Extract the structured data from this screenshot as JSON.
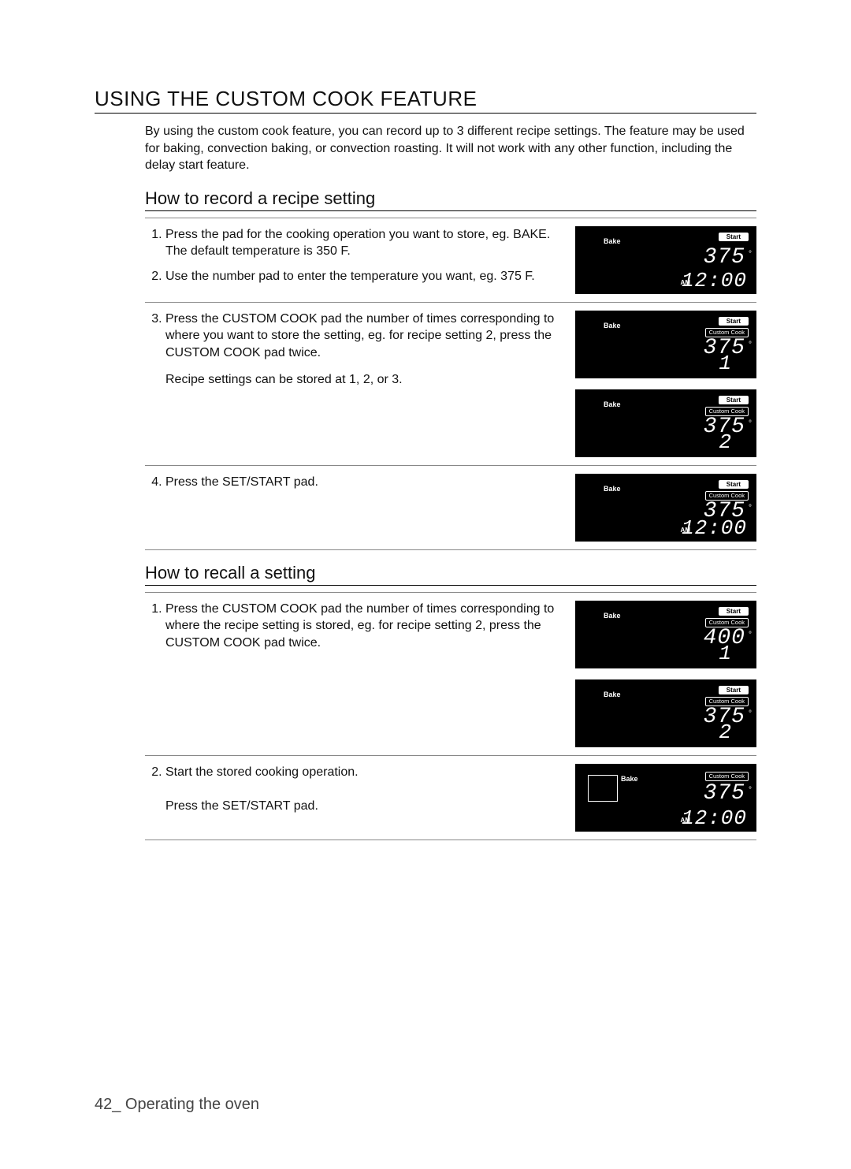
{
  "title": "USING THE CUSTOM COOK FEATURE",
  "intro": "By using the custom cook feature, you can record up to 3 different recipe settings. The feature may be used for baking, convection baking, or convection roasting. It will not work with any other function, including the delay start feature.",
  "section_record_title": "How to record a recipe setting",
  "record_steps": {
    "s1": "Press the pad for the cooking operation you want to store, eg. BAKE. The default temperature is 350 F.",
    "s2": "Use the number pad to enter the temperature you want, eg. 375 F.",
    "s3a": "Press the",
    "s3pad": "CUSTOM COOK",
    "s3b": " pad the number of times corresponding to where you want to store the setting, eg. for recipe setting 2, press the",
    "s3c": " pad twice.",
    "s3note": "Recipe settings can be stored at 1, 2, or 3.",
    "s4a": "Press the",
    "s4pad": "SET/START",
    "s4b": " pad."
  },
  "section_recall_title": "How to recall a setting",
  "recall_steps": {
    "r1a": "Press the",
    "r1pad": "CUSTOM COOK",
    "r1b": " pad the number of times corresponding to where the recipe setting is stored, eg. for recipe setting 2, press the",
    "r1c": " pad twice.",
    "r2a": "Start the stored cooking operation.",
    "r2b": "Press the",
    "r2pad": "SET/START",
    "r2c": " pad."
  },
  "display_labels": {
    "bake": "Bake",
    "start": "Start",
    "custom_cook": "Custom Cook",
    "am": "AM"
  },
  "displays": {
    "d1": {
      "temp": "375",
      "clock": "12:00"
    },
    "d2": {
      "temp": "375",
      "slot": "1"
    },
    "d3": {
      "temp": "375",
      "slot": "2"
    },
    "d4": {
      "temp": "375",
      "clock": "12:00"
    },
    "d5": {
      "temp": "400",
      "slot": "1"
    },
    "d6": {
      "temp": "375",
      "slot": "2"
    },
    "d7": {
      "temp": "375",
      "clock": "12:00"
    }
  },
  "footer_page": "42_",
  "footer_text": " Operating the oven"
}
